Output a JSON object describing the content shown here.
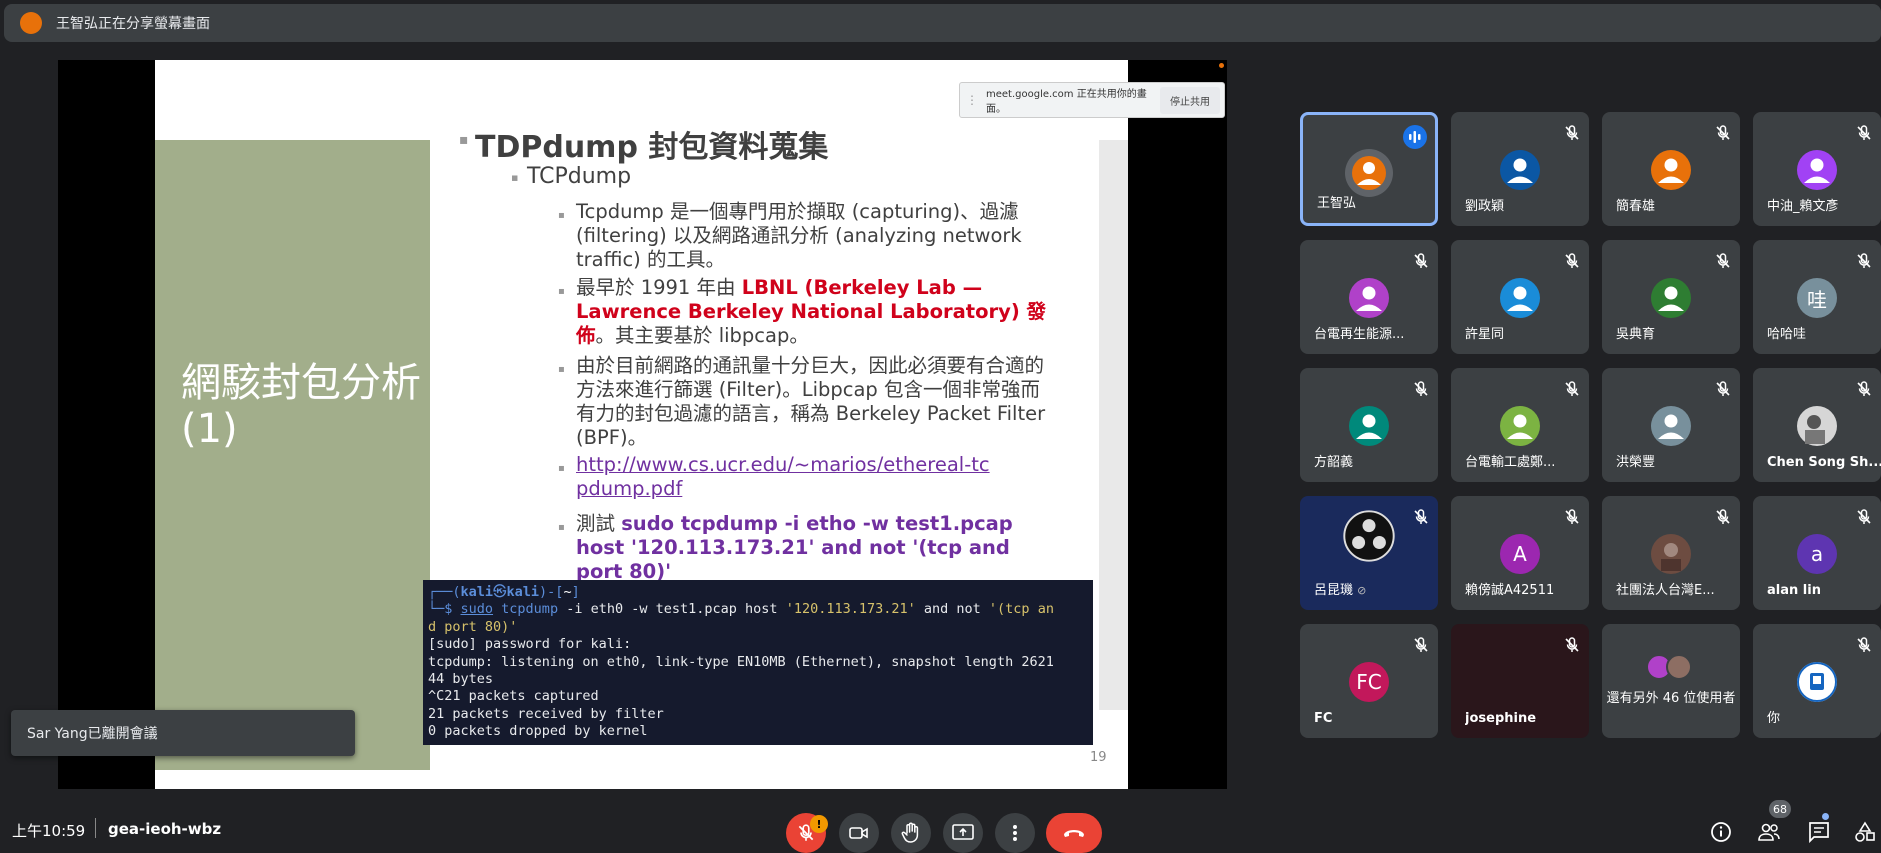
{
  "banner": {
    "text": "王智弘正在分享螢幕畫面"
  },
  "share_bar": {
    "text": "meet.google.com 正在共用你的畫面。",
    "stop_label": "停止共用"
  },
  "slide": {
    "section_title": "網駭封包分析 (1)",
    "heading": "TDPdump 封包資料蒐集",
    "sub": "TCPdump",
    "bullet1": "Tcpdump 是一個專門用於擷取 (capturing)、過濾 (filtering) 以及網路通訊分析 (analyzing network traffic) 的工具。",
    "bullet2_pre": "最早於 1991 年由 ",
    "bullet2_red": "LBNL (Berkeley Lab — Lawrence Berkeley National Laboratory) 發佈",
    "bullet2_post": "。其主要基於 libpcap。",
    "bullet3": "由於目前網路的通訊量十分巨大，因此必須要有合適的方法來進行篩選 (Filter)。Libpcap 包含一個非常強而有力的封包過濾的語言，稱為 Berkeley Packet Filter (BPF)。",
    "bullet4_link": "http://www.cs.ucr.edu/~marios/ethereal-tcpdump.pdf",
    "bullet5_pre": "測試 ",
    "bullet5_cmd": "sudo tcpdump -i etho -w test1.pcap host '120.113.173.21' and not '(tcp and port 80)'",
    "terminal": {
      "prompt_user": "kali",
      "prompt_host": "kali",
      "prompt_dir": "~",
      "cmd_sudo": "sudo",
      "cmd_tcpdump": "tcpdump",
      "cmd_args1": "-i eth0 -w test1.pcap host",
      "cmd_str1": "'120.113.173.21'",
      "cmd_and": "and not",
      "cmd_str2a": "'(tcp an",
      "cmd_str2b": "d port 80)'",
      "out1": "[sudo] password for kali:",
      "out2": "tcpdump: listening on eth0, link-type EN10MB (Ethernet), snapshot length 2621",
      "out3": "44 bytes",
      "out4": "^C21 packets captured",
      "out5": "21 packets received by filter",
      "out6": "0 packets dropped by kernel"
    },
    "page_number": "19"
  },
  "toast": {
    "text": "Sar Yang已離開會議"
  },
  "participants": [
    {
      "name": "王智弘",
      "avatar_color": "#e8710a",
      "speaking": true
    },
    {
      "name": "劉政穎",
      "avatar_color": "#0b57a4"
    },
    {
      "name": "簡春雄",
      "avatar_color": "#e8710a"
    },
    {
      "name": "中油_賴文彥",
      "avatar_color": "#a142f4"
    },
    {
      "name": "台電再生能源...",
      "avatar_color": "#b041c9"
    },
    {
      "name": "許星同",
      "avatar_color": "#1a8cd8"
    },
    {
      "name": "吳典育",
      "avatar_color": "#2e7d32"
    },
    {
      "name": "哈哈哇",
      "avatar_color": "#78909c",
      "initial": "哇"
    },
    {
      "name": "方韶義",
      "avatar_color": "#00897b"
    },
    {
      "name": "台電輸工處鄭...",
      "avatar_color": "#7cb342"
    },
    {
      "name": "洪榮豐",
      "avatar_color": "#78909c"
    },
    {
      "name": "Chen Song Sh...",
      "avatar_color": "#bdbdbd"
    },
    {
      "name": "呂昆璣",
      "avatar_color": "#111111"
    },
    {
      "name": "賴傍誠A42511",
      "avatar_color": "#9c27b0",
      "initial": "A"
    },
    {
      "name": "社團法人台灣E...",
      "avatar_color": "#6d4c41"
    },
    {
      "name": "alan lin",
      "avatar_color": "#5e35b1",
      "initial": "a"
    },
    {
      "name": "FC",
      "avatar_color": "#c2185b",
      "initial": "FC"
    },
    {
      "name": "josephine",
      "avatar_color": "#2a161b"
    },
    {
      "name": "還有另外 46 位使用者"
    },
    {
      "name": "你",
      "avatar_color": "#ffffff"
    }
  ],
  "bottom": {
    "time": "上午10:59",
    "meeting_code": "gea-ieoh-wbz",
    "alert_badge": "!",
    "people_count": "68"
  },
  "colors": {
    "accent": "#8ab4f8",
    "end_call": "#ea4335",
    "surface": "#3c4043"
  }
}
